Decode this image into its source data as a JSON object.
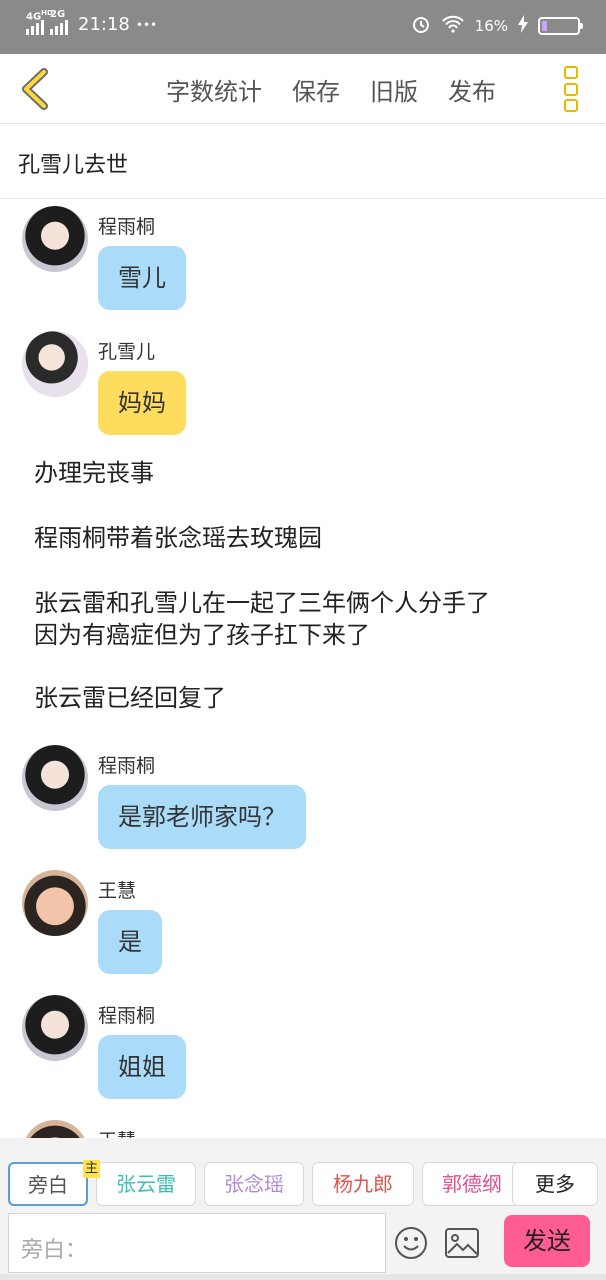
{
  "status_bar": {
    "network_1": "4G",
    "network_1_sup": "HD",
    "network_2": "2G",
    "time": "21:18",
    "more": "•••",
    "battery_text": "16%",
    "battery_level": 0.16
  },
  "toolbar": {
    "back_icon": "chevron-left-icon",
    "word_count": "字数统计",
    "save": "保存",
    "old_version": "旧版",
    "publish": "发布",
    "menu_icon": "vertical-dots-icon"
  },
  "title": "孔雪儿去世",
  "chat": {
    "messages": [
      {
        "sender": "程雨桐",
        "text": "雪儿",
        "color": "blue",
        "avatar": "cheng"
      },
      {
        "sender": "孔雪儿",
        "text": "妈妈",
        "color": "yellow",
        "avatar": "kong"
      }
    ],
    "narration": [
      "办理完丧事",
      "程雨桐带着张念瑶去玫瑰园",
      "张云雷和孔雪儿在一起了三年俩个人分手了",
      "因为有癌症但为了孩子扛下来了",
      "张云雷已经回复了"
    ],
    "messages_2": [
      {
        "sender": "程雨桐",
        "text": "是郭老师家吗？",
        "color": "blue",
        "avatar": "cheng"
      },
      {
        "sender": "王慧",
        "text": "是",
        "color": "blue",
        "avatar": "wang"
      },
      {
        "sender": "程雨桐",
        "text": "姐姐",
        "color": "blue",
        "avatar": "cheng"
      },
      {
        "sender": "王慧",
        "text": "",
        "color": "blue",
        "avatar": "wang"
      }
    ]
  },
  "roles": {
    "chips": [
      {
        "label": "旁白",
        "color": "#555555"
      },
      {
        "label": "张云雷",
        "color": "#3bbfb0",
        "badge": "主"
      },
      {
        "label": "张念瑶",
        "color": "#b08ad8"
      },
      {
        "label": "杨九郎",
        "color": "#e0554d"
      },
      {
        "label": "郭德纲",
        "color": "#e0508c"
      },
      {
        "label": "更多",
        "color": "#555555"
      }
    ]
  },
  "input": {
    "placeholder": "旁白：",
    "emoji_icon": "smiley-icon",
    "image_icon": "image-icon",
    "send": "发送"
  },
  "colors": {
    "bubble_blue": "#aadcf9",
    "bubble_yellow": "#ffdc5e",
    "send_button": "#ff5c93",
    "accent": "#e6b800"
  }
}
